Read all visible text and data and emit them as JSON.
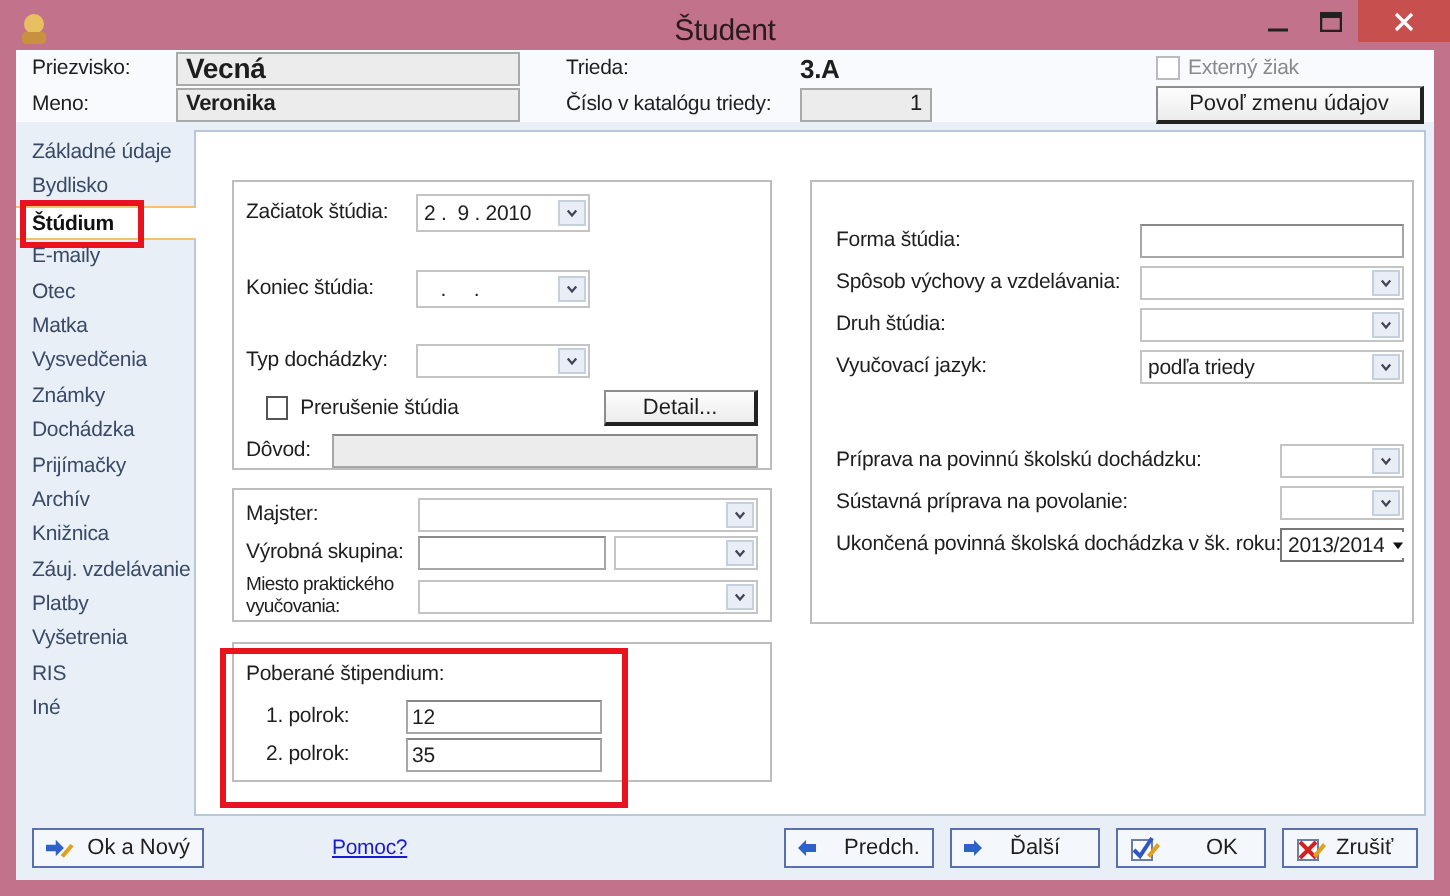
{
  "window": {
    "title": "Študent"
  },
  "header": {
    "surname_label": "Priezvisko:",
    "surname": "Vecná",
    "name_label": "Meno:",
    "name": "Veronika",
    "class_label": "Trieda:",
    "class": "3.A",
    "catalog_label": "Číslo v katalógu triedy:",
    "catalog": "1",
    "external": {
      "label": "Externý žiak",
      "checked": false,
      "disabled": true
    },
    "allow_button": "Povoľ zmenu údajov"
  },
  "sidebar": {
    "items": [
      {
        "label": "Základné údaje",
        "selected": false,
        "highlighted": false
      },
      {
        "label": "Bydlisko",
        "selected": false,
        "highlighted": false
      },
      {
        "label": "Štúdium",
        "selected": true,
        "highlighted": true
      },
      {
        "label": "E-maily",
        "selected": false,
        "highlighted": false
      },
      {
        "label": "Otec",
        "selected": false,
        "highlighted": false
      },
      {
        "label": "Matka",
        "selected": false,
        "highlighted": false
      },
      {
        "label": "Vysvedčenia",
        "selected": false,
        "highlighted": false
      },
      {
        "label": "Známky",
        "selected": false,
        "highlighted": false
      },
      {
        "label": "Dochádzka",
        "selected": false,
        "highlighted": false
      },
      {
        "label": "Prijímačky",
        "selected": false,
        "highlighted": false
      },
      {
        "label": "Archív",
        "selected": false,
        "highlighted": false
      },
      {
        "label": "Knižnica",
        "selected": false,
        "highlighted": false
      },
      {
        "label": "Záuj. vzdelávanie",
        "selected": false,
        "highlighted": false
      },
      {
        "label": "Platby",
        "selected": false,
        "highlighted": false
      },
      {
        "label": "Vyšetrenia",
        "selected": false,
        "highlighted": false
      },
      {
        "label": "RIS",
        "selected": false,
        "highlighted": false
      },
      {
        "label": "Iné",
        "selected": false,
        "highlighted": false
      }
    ]
  },
  "study": {
    "start": {
      "label": "Začiatok štúdia:",
      "value": "2 .  9 . 2010"
    },
    "end": {
      "label": "Koniec štúdia:",
      "value": "   .     ."
    },
    "attendance": {
      "label": "Typ dochádzky:"
    },
    "interruption": {
      "label": "Prerušenie štúdia",
      "checked": false
    },
    "detail_button": "Detail...",
    "reason": {
      "label": "Dôvod:",
      "disabled": true
    }
  },
  "practical": {
    "master": {
      "label": "Majster:"
    },
    "group": {
      "label": "Výrobná skupina:"
    },
    "place": {
      "label": "Miesto praktického vyučovania:"
    }
  },
  "stipend": {
    "title": "Poberané štipendium:",
    "highlighted": true,
    "rows": [
      {
        "label": "1. polrok:",
        "value": "12"
      },
      {
        "label": "2. polrok:",
        "value": "35"
      }
    ]
  },
  "details": {
    "groups": [
      {
        "fields": [
          {
            "label": "Forma štúdia:",
            "kind": "text"
          },
          {
            "label": "Spôsob výchovy a vzdelávania:",
            "kind": "combo"
          },
          {
            "label": "Druh štúdia:",
            "kind": "combo"
          },
          {
            "label": "Vyučovací jazyk:",
            "kind": "combo",
            "value": "podľa triedy"
          }
        ]
      },
      {
        "fields": [
          {
            "label": "Príprava na povinnú školskú dochádzku:",
            "kind": "combo"
          },
          {
            "label": "Sústavná príprava na povolanie:",
            "kind": "combo"
          },
          {
            "label": "Ukončená povinná školská dochádzka v šk. roku:",
            "kind": "list",
            "value": "2013/2014"
          }
        ]
      }
    ]
  },
  "footer": {
    "ok_new": "Ok a Nový",
    "help_link": "Pomoc?",
    "buttons": [
      {
        "label": "Predch.",
        "kind": "prev"
      },
      {
        "label": "Ďalší",
        "kind": "next"
      },
      {
        "label": "OK",
        "kind": "ok"
      },
      {
        "label": "Zrušiť",
        "kind": "cancel"
      }
    ]
  }
}
